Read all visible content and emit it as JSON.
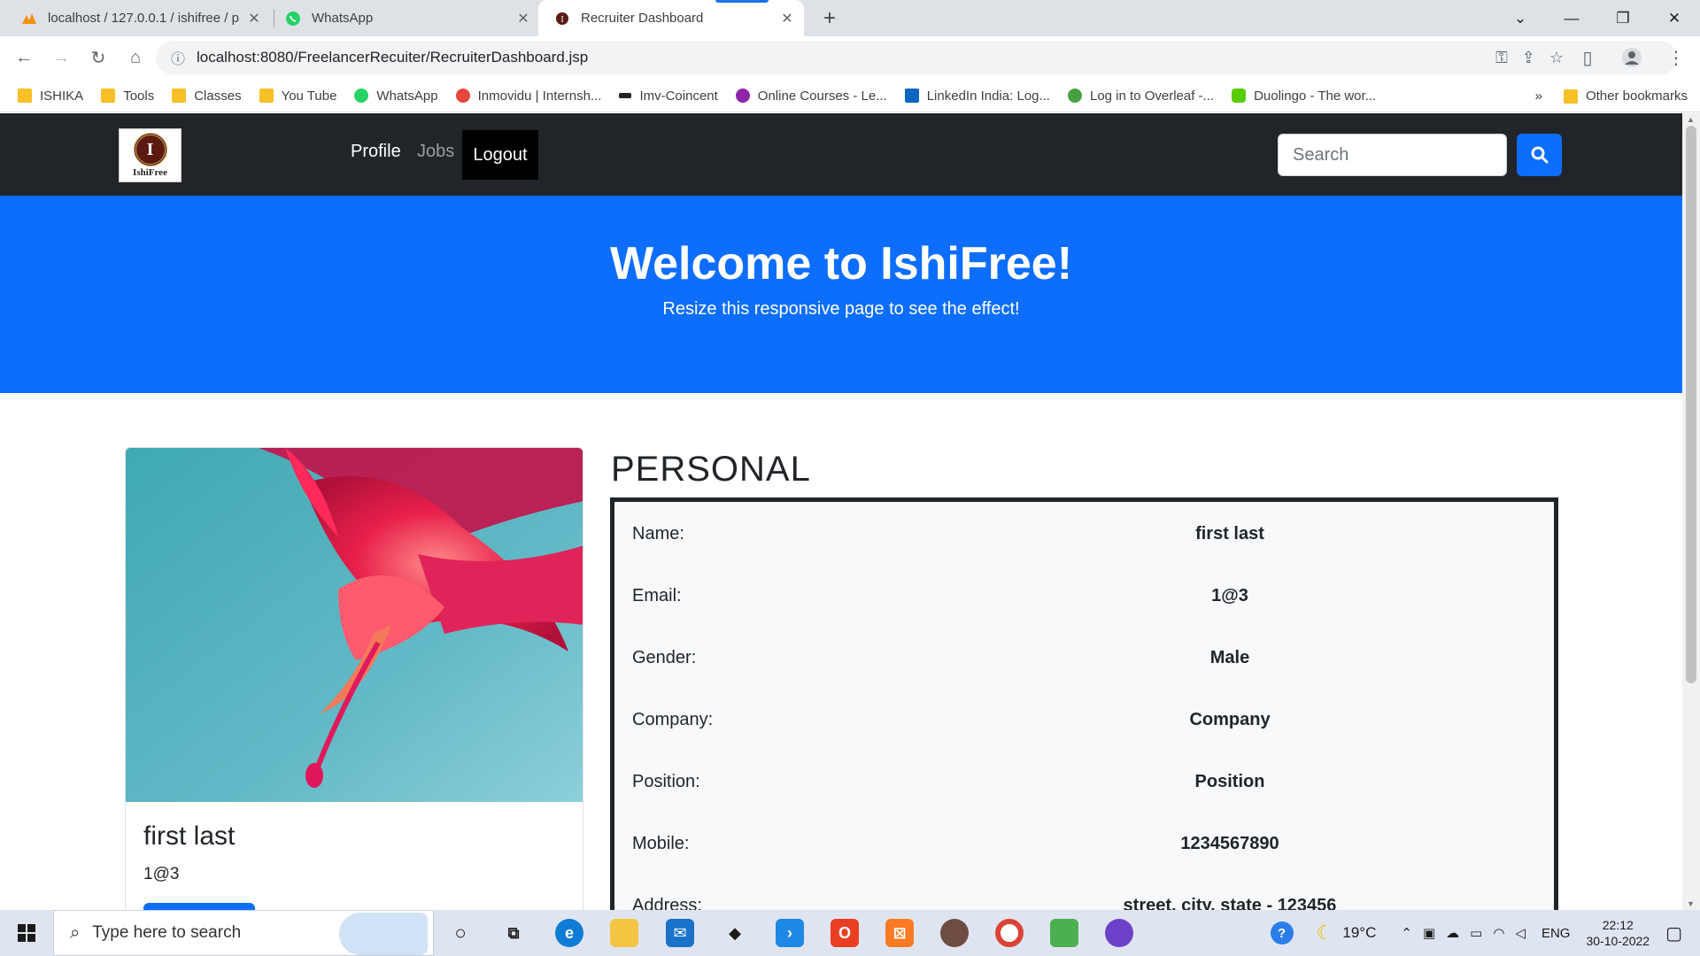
{
  "browser": {
    "tabs": [
      {
        "title": "localhost / 127.0.0.1 / ishifree / p",
        "icon": "phpmyadmin-icon"
      },
      {
        "title": "WhatsApp",
        "icon": "whatsapp-icon"
      },
      {
        "title": "Recruiter Dashboard",
        "icon": "ishifree-icon",
        "active": true
      }
    ],
    "url": "localhost:8080/FreelancerRecuiter/RecruiterDashboard.jsp",
    "bookmarks": [
      {
        "label": "ISHIKA",
        "icon": "folder-icon"
      },
      {
        "label": "Tools",
        "icon": "folder-icon"
      },
      {
        "label": "Classes",
        "icon": "folder-icon"
      },
      {
        "label": "You Tube",
        "icon": "folder-icon"
      },
      {
        "label": "WhatsApp",
        "icon": "whatsapp-icon"
      },
      {
        "label": "Inmovidu | Internsh...",
        "icon": "inmovidu-icon"
      },
      {
        "label": "Imv-Coincent",
        "icon": "imv-icon"
      },
      {
        "label": "Online Courses - Le...",
        "icon": "courses-icon"
      },
      {
        "label": "LinkedIn India: Log...",
        "icon": "linkedin-icon"
      },
      {
        "label": "Log in to Overleaf -...",
        "icon": "overleaf-icon"
      },
      {
        "label": "Duolingo - The wor...",
        "icon": "duolingo-icon"
      }
    ],
    "bookmarks_more": "»",
    "other_bookmarks": "Other bookmarks"
  },
  "site": {
    "logo_letter": "I",
    "logo_text": "IshiFree",
    "nav": {
      "profile": "Profile",
      "jobs": "Jobs",
      "logout": "Logout"
    },
    "search_placeholder": "Search",
    "hero": {
      "title": "Welcome to IshiFree!",
      "subtitle": "Resize this responsive page to see the effect!"
    },
    "card": {
      "name": "first last",
      "email": "1@3"
    },
    "section_title": "PERSONAL",
    "personal": [
      {
        "label": "Name:",
        "value": "first last"
      },
      {
        "label": "Email:",
        "value": "1@3"
      },
      {
        "label": "Gender:",
        "value": "Male"
      },
      {
        "label": "Company:",
        "value": "Company"
      },
      {
        "label": "Position:",
        "value": "Position"
      },
      {
        "label": "Mobile:",
        "value": "1234567890"
      },
      {
        "label": "Address:",
        "value": "street, city, state - 123456"
      }
    ]
  },
  "taskbar": {
    "search_placeholder": "Type here to search",
    "weather": "19°C",
    "language": "ENG",
    "time": "22:12",
    "date": "30-10-2022"
  },
  "colors": {
    "primary": "#0d6efd",
    "navbar": "#212529"
  }
}
